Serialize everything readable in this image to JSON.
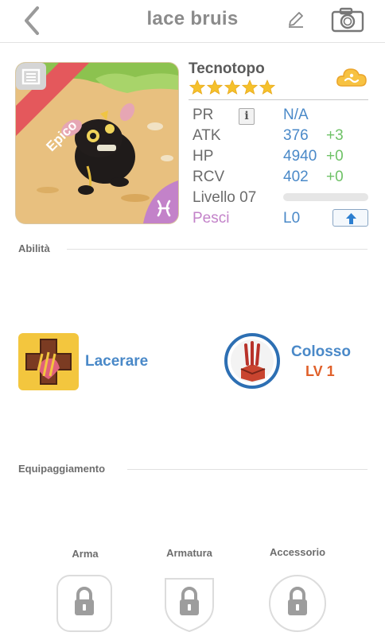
{
  "header": {
    "title": "lace bruis",
    "back_icon": "chevron-left-icon",
    "edit_icon": "pencil-icon",
    "camera_icon": "camera-icon"
  },
  "monster": {
    "rarity": "Epico",
    "name": "Tecnotopo",
    "stars": 5,
    "element_icon": "pisces-icon",
    "badge_icon": "cloud-icon"
  },
  "stats": {
    "pr": {
      "label": "PR",
      "value": "N/A"
    },
    "atk": {
      "label": "ATK",
      "value": "376",
      "bonus": "+3"
    },
    "hp": {
      "label": "HP",
      "value": "4940",
      "bonus": "+0"
    },
    "rcv": {
      "label": "RCV",
      "value": "402",
      "bonus": "+0"
    },
    "level": {
      "label": "Livello 07",
      "progress": 0
    },
    "sign": {
      "label": "Pesci",
      "value": "L0"
    }
  },
  "sections": {
    "abilities": "Abilità",
    "equipment": "Equipaggiamento"
  },
  "abilities": [
    {
      "name": "Lacerare"
    },
    {
      "name": "Colosso",
      "level": "LV 1"
    }
  ],
  "equipment": {
    "weapon": "Arma",
    "armor": "Armatura",
    "accessory": "Accessorio"
  },
  "colors": {
    "accent_blue": "#4a89c8",
    "bonus_green": "#6fc267",
    "rarity_red": "#e4585c",
    "pisces_purple": "#c382c9",
    "level_orange": "#e0602a",
    "ability_yellow": "#f3c63e"
  }
}
